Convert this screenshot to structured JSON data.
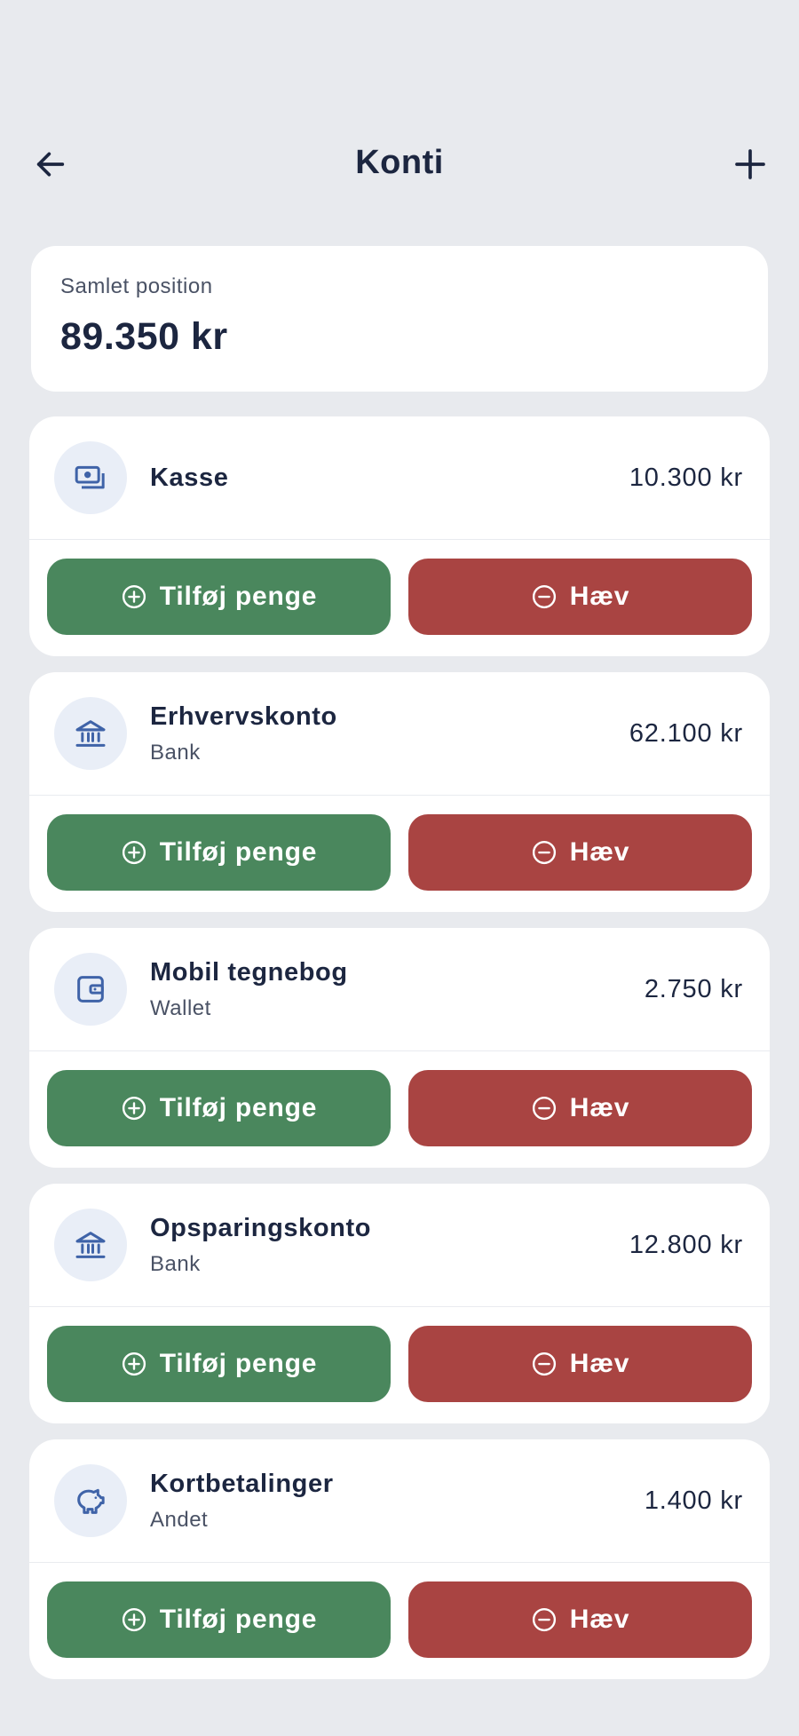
{
  "header": {
    "title": "Konti",
    "back_icon": "arrow-left-icon",
    "add_icon": "plus-icon"
  },
  "summary": {
    "label": "Samlet position",
    "value": "89.350 kr"
  },
  "colors": {
    "background": "#E8EAEE",
    "card": "#FFFFFF",
    "text_primary": "#1C2640",
    "text_secondary": "#4A5265",
    "icon_accent": "#3F63A8",
    "icon_bg": "#E9EEF7",
    "add_button": "#4A875D",
    "withdraw_button": "#A94442"
  },
  "accounts": [
    {
      "name": "Kasse",
      "type": "",
      "amount": "10.300 kr",
      "icon": "cash-icon",
      "add_label": "Tilføj penge",
      "withdraw_label": "Hæv"
    },
    {
      "name": "Erhvervskonto",
      "type": "Bank",
      "amount": "62.100 kr",
      "icon": "bank-icon",
      "add_label": "Tilføj penge",
      "withdraw_label": "Hæv"
    },
    {
      "name": "Mobil tegnebog",
      "type": "Wallet",
      "amount": "2.750 kr",
      "icon": "wallet-icon",
      "add_label": "Tilføj penge",
      "withdraw_label": "Hæv"
    },
    {
      "name": "Opsparingskonto",
      "type": "Bank",
      "amount": "12.800 kr",
      "icon": "bank-icon",
      "add_label": "Tilføj penge",
      "withdraw_label": "Hæv"
    },
    {
      "name": "Kortbetalinger",
      "type": "Andet",
      "amount": "1.400 kr",
      "icon": "piggy-bank-icon",
      "add_label": "Tilføj penge",
      "withdraw_label": "Hæv"
    }
  ]
}
